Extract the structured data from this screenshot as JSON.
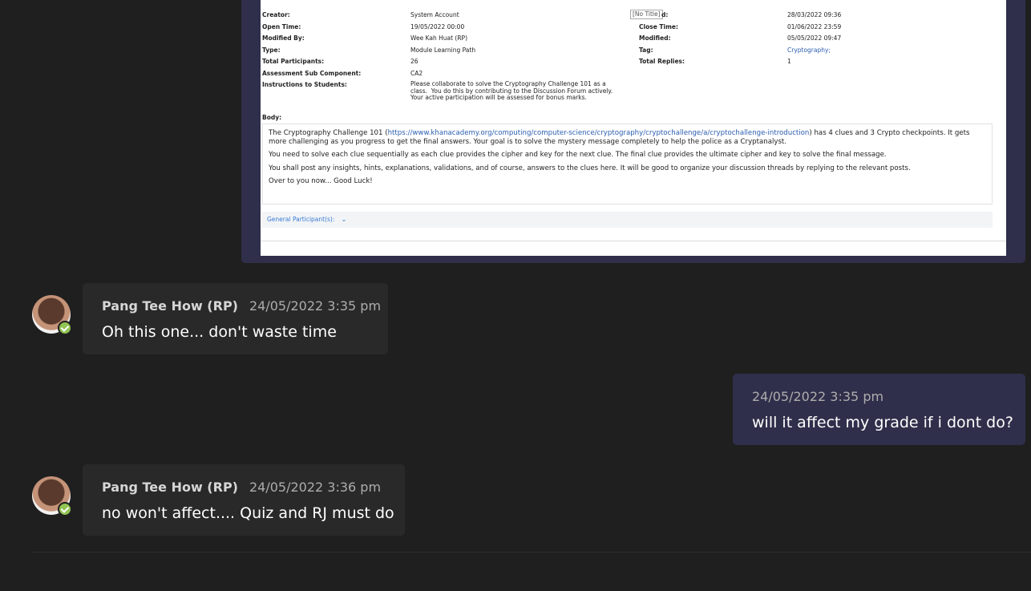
{
  "shared_image": {
    "fields_left": [
      {
        "label": "Creator:",
        "value": "System Account"
      },
      {
        "label": "Open Time:",
        "value": "19/05/2022 00:00"
      },
      {
        "label": "Modified By:",
        "value": "Wee Kah Huat (RP)"
      },
      {
        "label": "Type:",
        "value": "Module Learning Path"
      },
      {
        "label": "Total Participants:",
        "value": "26"
      },
      {
        "label": "Assessment Sub Component:",
        "value": "CA2"
      },
      {
        "label": "Instructions to Students:",
        "value": "Please collaborate to solve the Cryptography Challenge 101 as a\nclass.  You do this by contributing to the Discussion Forum actively.\nYour active participation will be assessed for bonus marks."
      }
    ],
    "fields_right": [
      {
        "label": "d:",
        "value": "28/03/2022 09:36"
      },
      {
        "label": "Close Time:",
        "value": "01/06/2022 23:59"
      },
      {
        "label": "Modified:",
        "value": "05/05/2022 09:47"
      },
      {
        "label": "Tag:",
        "value": "Cryptography;"
      },
      {
        "label": "Total Replies:",
        "value": "1"
      }
    ],
    "no_title": "[No Title]",
    "body_label": "Body:",
    "body_p1_before": "The Cryptography Challenge 101 (",
    "body_p1_link": "https://www.khanacademy.org/computing/computer-science/cryptography/cryptochallenge/a/cryptochallenge-introduction",
    "body_p1_after": ") has 4 clues and 3 Crypto checkpoints.  It gets more challenging as you progress to get the final answers.  Your goal is to solve the mystery message completely to help the police as a Cryptanalyst.",
    "body_p2": "You need to solve each clue sequentially as each clue provides the cipher and key for the next clue.  The final clue provides the ultimate cipher and key to solve the final message.",
    "body_p3": "You shall post any insights, hints, explanations, validations, and of course, answers to the clues here.  It will be good to organize your discussion threads by replying to the relevant posts.",
    "body_p4": "Over to you now... Good Luck!",
    "participants": "General Participant(s):",
    "participants_chevron": "⌄"
  },
  "messages": [
    {
      "sender": "Pang Tee How (RP)",
      "time": "24/05/2022 3:35 pm",
      "text": "Oh this one... don't waste time"
    },
    {
      "sender": "",
      "time": "24/05/2022 3:35 pm",
      "text": "will it affect my grade if i dont do?"
    },
    {
      "sender": "Pang Tee How (RP)",
      "time": "24/05/2022 3:36 pm",
      "text": "no won't affect.... Quiz and RJ must do"
    }
  ],
  "colors": {
    "background": "#1f1f1f",
    "other_bubble": "#292929",
    "own_bubble": "#2f2f4b",
    "presence_available": "#92c353"
  }
}
